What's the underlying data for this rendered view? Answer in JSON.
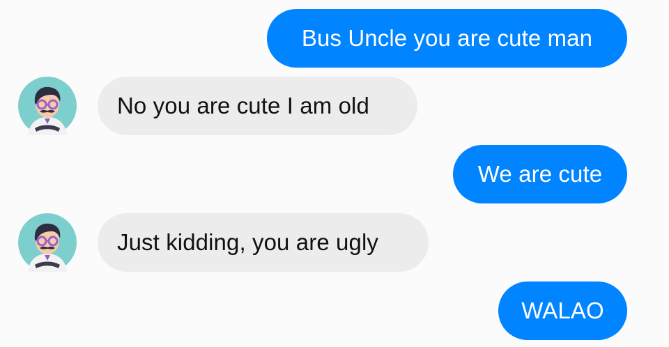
{
  "conversation": {
    "messages": [
      {
        "sender": "me",
        "text": "Bus Uncle you are cute man"
      },
      {
        "sender": "bus-uncle",
        "text": "No you are cute I am old"
      },
      {
        "sender": "me",
        "text": "We are cute"
      },
      {
        "sender": "bus-uncle",
        "text": "Just kidding, you are ugly"
      },
      {
        "sender": "me",
        "text": "WALAO"
      }
    ]
  },
  "colors": {
    "outgoing_bubble": "#0084ff",
    "incoming_bubble": "#ececec",
    "background": "#fbfbfb",
    "avatar_background": "#7ccfcc"
  },
  "icons": {
    "avatar": "bus-uncle-avatar-icon"
  }
}
